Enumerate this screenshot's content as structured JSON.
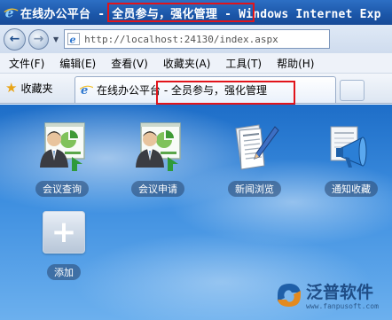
{
  "window": {
    "title": "在线办公平台 - 全员参与，强化管理 - Windows Internet Exp"
  },
  "address": {
    "url": "http://localhost:24130/index.aspx"
  },
  "menu": {
    "items": [
      "文件(F)",
      "编辑(E)",
      "查看(V)",
      "收藏夹(A)",
      "工具(T)",
      "帮助(H)"
    ]
  },
  "favorites": {
    "label": "收藏夹"
  },
  "tab": {
    "title": "在线办公平台 - 全员参与，强化管理"
  },
  "apps": [
    {
      "label": "会议查询",
      "icon": "meeting-presenter-icon"
    },
    {
      "label": "会议申请",
      "icon": "meeting-presenter-icon"
    },
    {
      "label": "新闻浏览",
      "icon": "newspaper-icon"
    },
    {
      "label": "通知收藏",
      "icon": "megaphone-icon"
    },
    {
      "label": "添加",
      "icon": "add-icon"
    }
  ],
  "brand": {
    "name": "泛普软件",
    "url": "www.fanpusoft.com"
  },
  "colors": {
    "highlight": "#e1141b",
    "titlebar": "#1b56a8"
  }
}
